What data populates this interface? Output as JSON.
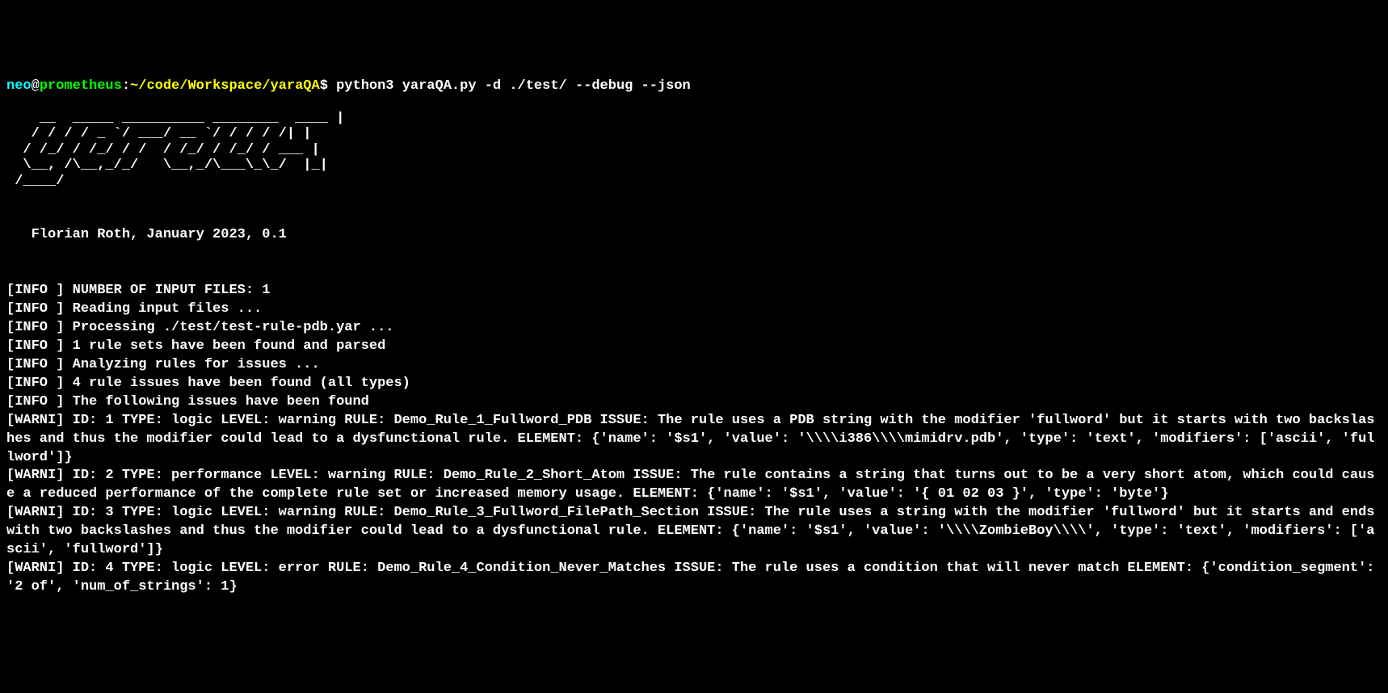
{
  "prompt": {
    "user": "neo",
    "at": "@",
    "host": "prometheus",
    "colon": ":",
    "path": "~/code/Workspace/yaraQA",
    "dollar": "$",
    "command": " python3 yaraQA.py -d ./test/ --debug --json"
  },
  "ascii_art": "    __  _____ __________ ________  ____ |\n   / / / / _ `/ ___/ __ `/ / / / /| |\n  / /_/ / /_/ / /  / /_/ / /_/ / ___ |\n  \\__, /\\__,_/_/   \\__,_/\\___\\_\\_/  |_|\n /____/",
  "byline": "   Florian Roth, January 2023, 0.1",
  "log_lines": [
    "[INFO ] NUMBER OF INPUT FILES: 1",
    "[INFO ] Reading input files ...",
    "[INFO ] Processing ./test/test-rule-pdb.yar ...",
    "[INFO ] 1 rule sets have been found and parsed",
    "[INFO ] Analyzing rules for issues ...",
    "[INFO ] 4 rule issues have been found (all types)",
    "[INFO ] The following issues have been found",
    "[WARNI] ID: 1 TYPE: logic LEVEL: warning RULE: Demo_Rule_1_Fullword_PDB ISSUE: The rule uses a PDB string with the modifier 'fullword' but it starts with two backslashes and thus the modifier could lead to a dysfunctional rule. ELEMENT: {'name': '$s1', 'value': '\\\\\\\\i386\\\\\\\\mimidrv.pdb', 'type': 'text', 'modifiers': ['ascii', 'fullword']}",
    "[WARNI] ID: 2 TYPE: performance LEVEL: warning RULE: Demo_Rule_2_Short_Atom ISSUE: The rule contains a string that turns out to be a very short atom, which could cause a reduced performance of the complete rule set or increased memory usage. ELEMENT: {'name': '$s1', 'value': '{ 01 02 03 }', 'type': 'byte'}",
    "[WARNI] ID: 3 TYPE: logic LEVEL: warning RULE: Demo_Rule_3_Fullword_FilePath_Section ISSUE: The rule uses a string with the modifier 'fullword' but it starts and ends with two backslashes and thus the modifier could lead to a dysfunctional rule. ELEMENT: {'name': '$s1', 'value': '\\\\\\\\ZombieBoy\\\\\\\\', 'type': 'text', 'modifiers': ['ascii', 'fullword']}",
    "[WARNI] ID: 4 TYPE: logic LEVEL: error RULE: Demo_Rule_4_Condition_Never_Matches ISSUE: The rule uses a condition that will never match ELEMENT: {'condition_segment': '2 of', 'num_of_strings': 1}"
  ]
}
